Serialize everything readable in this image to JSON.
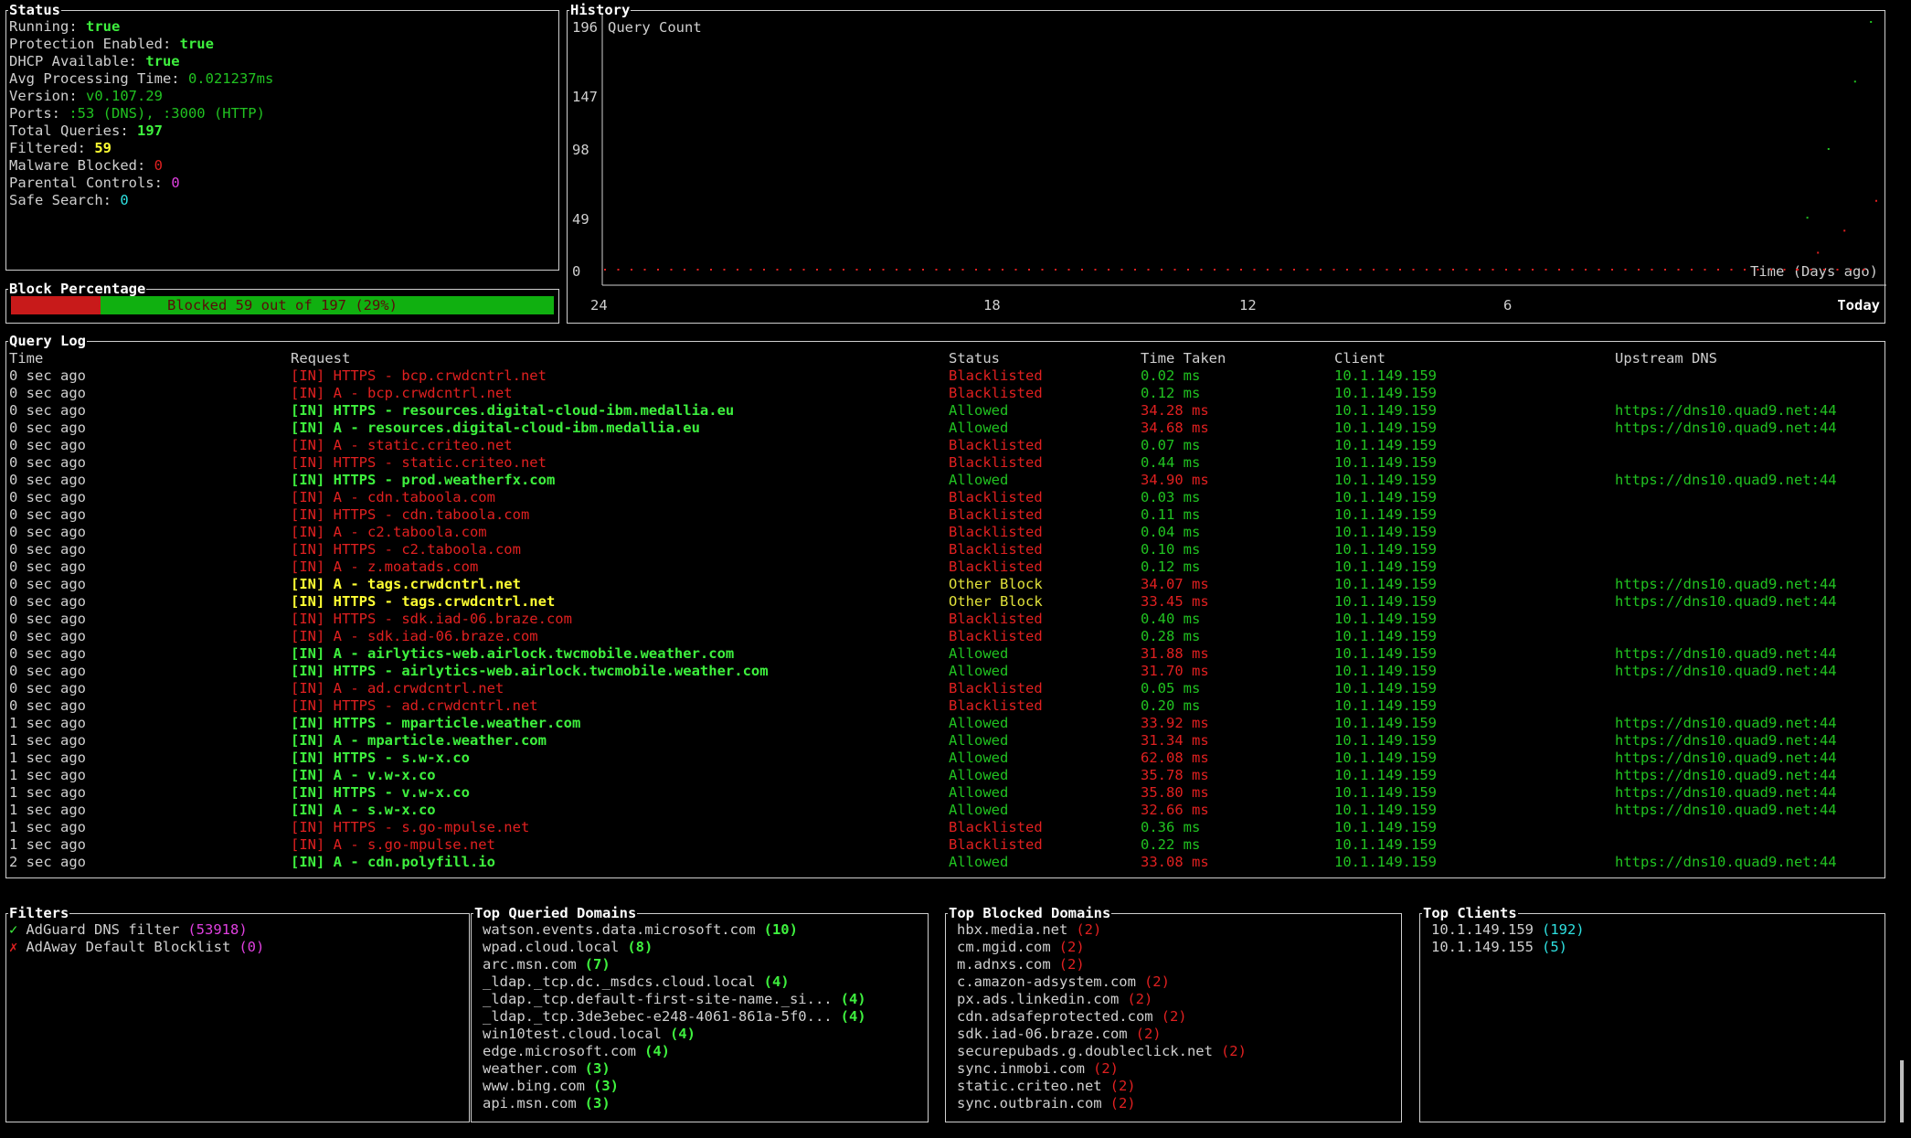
{
  "status": {
    "title": "Status",
    "items": [
      {
        "label": "Running: ",
        "value": "true",
        "cls": "gb"
      },
      {
        "label": "Protection Enabled: ",
        "value": "true",
        "cls": "gb"
      },
      {
        "label": "DHCP Available: ",
        "value": "true",
        "cls": "gb"
      },
      {
        "label": "Avg Processing Time: ",
        "value": "0.021237ms",
        "cls": "g"
      },
      {
        "label": "Version: ",
        "value": "v0.107.29",
        "cls": "g"
      },
      {
        "label": "Ports: ",
        "value": ":53 (DNS), :3000 (HTTP)",
        "cls": "g"
      },
      {
        "label": "Total Queries: ",
        "value": "197",
        "cls": "gb"
      },
      {
        "label": "Filtered: ",
        "value": "59",
        "cls": "y"
      },
      {
        "label": "Malware Blocked: ",
        "value": "0",
        "cls": "r"
      },
      {
        "label": "Parental Controls: ",
        "value": "0",
        "cls": "m"
      },
      {
        "label": "Safe Search: ",
        "value": "0",
        "cls": "c"
      }
    ]
  },
  "block_percentage": {
    "title": "Block Percentage",
    "text": "Blocked 59 out of 197 (29%)",
    "fraction": 0.2995
  },
  "history": {
    "title": "History",
    "series_label": "Query Count",
    "x_label": "Time (Days ago)",
    "y_ticks": [
      "196",
      "147",
      "98",
      "49",
      "0"
    ],
    "x_ticks": [
      "24",
      "18",
      "12",
      "6",
      "Today"
    ]
  },
  "chart_data": {
    "type": "scatter",
    "title": "History",
    "xlabel": "Time (Days ago)",
    "ylabel": "Query Count",
    "ylim": [
      0,
      196
    ],
    "xlim": [
      24,
      0
    ],
    "series": [
      {
        "color": "#21c221",
        "x": [
          0.1,
          0.4,
          0.9,
          1.3
        ],
        "y": [
          196,
          150,
          98,
          45
        ]
      },
      {
        "color": "#e02020",
        "x": [
          0.0,
          0.6,
          1.1,
          1.5
        ],
        "y": [
          58,
          35,
          18,
          5
        ]
      }
    ]
  },
  "query_log": {
    "title": "Query Log",
    "headers": [
      "Time",
      "Request",
      "Status",
      "Time Taken",
      "Client",
      "Upstream DNS"
    ],
    "rows": [
      [
        "0 sec ago",
        "[IN] HTTPS - bcp.crwdcntrl.net",
        "Blacklisted",
        "0.02 ms",
        "10.1.149.159",
        "",
        "b"
      ],
      [
        "0 sec ago",
        "[IN] A - bcp.crwdcntrl.net",
        "Blacklisted",
        "0.12 ms",
        "10.1.149.159",
        "",
        "b"
      ],
      [
        "0 sec ago",
        "[IN] HTTPS - resources.digital-cloud-ibm.medallia.eu",
        "Allowed",
        "34.28 ms",
        "10.1.149.159",
        "https://dns10.quad9.net:44",
        "a"
      ],
      [
        "0 sec ago",
        "[IN] A - resources.digital-cloud-ibm.medallia.eu",
        "Allowed",
        "34.68 ms",
        "10.1.149.159",
        "https://dns10.quad9.net:44",
        "a"
      ],
      [
        "0 sec ago",
        "[IN] A - static.criteo.net",
        "Blacklisted",
        "0.07 ms",
        "10.1.149.159",
        "",
        "b"
      ],
      [
        "0 sec ago",
        "[IN] HTTPS - static.criteo.net",
        "Blacklisted",
        "0.44 ms",
        "10.1.149.159",
        "",
        "b"
      ],
      [
        "0 sec ago",
        "[IN] HTTPS - prod.weatherfx.com",
        "Allowed",
        "34.90 ms",
        "10.1.149.159",
        "https://dns10.quad9.net:44",
        "a"
      ],
      [
        "0 sec ago",
        "[IN] A - cdn.taboola.com",
        "Blacklisted",
        "0.03 ms",
        "10.1.149.159",
        "",
        "b"
      ],
      [
        "0 sec ago",
        "[IN] HTTPS - cdn.taboola.com",
        "Blacklisted",
        "0.11 ms",
        "10.1.149.159",
        "",
        "b"
      ],
      [
        "0 sec ago",
        "[IN] A - c2.taboola.com",
        "Blacklisted",
        "0.04 ms",
        "10.1.149.159",
        "",
        "b"
      ],
      [
        "0 sec ago",
        "[IN] HTTPS - c2.taboola.com",
        "Blacklisted",
        "0.10 ms",
        "10.1.149.159",
        "",
        "b"
      ],
      [
        "0 sec ago",
        "[IN] A - z.moatads.com",
        "Blacklisted",
        "0.12 ms",
        "10.1.149.159",
        "",
        "b"
      ],
      [
        "0 sec ago",
        "[IN] A - tags.crwdcntrl.net",
        "Other Block",
        "34.07 ms",
        "10.1.149.159",
        "https://dns10.quad9.net:44",
        "o"
      ],
      [
        "0 sec ago",
        "[IN] HTTPS - tags.crwdcntrl.net",
        "Other Block",
        "33.45 ms",
        "10.1.149.159",
        "https://dns10.quad9.net:44",
        "o"
      ],
      [
        "0 sec ago",
        "[IN] HTTPS - sdk.iad-06.braze.com",
        "Blacklisted",
        "0.40 ms",
        "10.1.149.159",
        "",
        "b"
      ],
      [
        "0 sec ago",
        "[IN] A - sdk.iad-06.braze.com",
        "Blacklisted",
        "0.28 ms",
        "10.1.149.159",
        "",
        "b"
      ],
      [
        "0 sec ago",
        "[IN] A - airlytics-web.airlock.twcmobile.weather.com",
        "Allowed",
        "31.88 ms",
        "10.1.149.159",
        "https://dns10.quad9.net:44",
        "a"
      ],
      [
        "0 sec ago",
        "[IN] HTTPS - airlytics-web.airlock.twcmobile.weather.com",
        "Allowed",
        "31.70 ms",
        "10.1.149.159",
        "https://dns10.quad9.net:44",
        "a"
      ],
      [
        "0 sec ago",
        "[IN] A - ad.crwdcntrl.net",
        "Blacklisted",
        "0.05 ms",
        "10.1.149.159",
        "",
        "b"
      ],
      [
        "0 sec ago",
        "[IN] HTTPS - ad.crwdcntrl.net",
        "Blacklisted",
        "0.20 ms",
        "10.1.149.159",
        "",
        "b"
      ],
      [
        "1 sec ago",
        "[IN] HTTPS - mparticle.weather.com",
        "Allowed",
        "33.92 ms",
        "10.1.149.159",
        "https://dns10.quad9.net:44",
        "a"
      ],
      [
        "1 sec ago",
        "[IN] A - mparticle.weather.com",
        "Allowed",
        "31.34 ms",
        "10.1.149.159",
        "https://dns10.quad9.net:44",
        "a"
      ],
      [
        "1 sec ago",
        "[IN] HTTPS - s.w-x.co",
        "Allowed",
        "62.08 ms",
        "10.1.149.159",
        "https://dns10.quad9.net:44",
        "a"
      ],
      [
        "1 sec ago",
        "[IN] A - v.w-x.co",
        "Allowed",
        "35.78 ms",
        "10.1.149.159",
        "https://dns10.quad9.net:44",
        "a"
      ],
      [
        "1 sec ago",
        "[IN] HTTPS - v.w-x.co",
        "Allowed",
        "35.80 ms",
        "10.1.149.159",
        "https://dns10.quad9.net:44",
        "a"
      ],
      [
        "1 sec ago",
        "[IN] A - s.w-x.co",
        "Allowed",
        "32.66 ms",
        "10.1.149.159",
        "https://dns10.quad9.net:44",
        "a"
      ],
      [
        "1 sec ago",
        "[IN] HTTPS - s.go-mpulse.net",
        "Blacklisted",
        "0.36 ms",
        "10.1.149.159",
        "",
        "b"
      ],
      [
        "1 sec ago",
        "[IN] A - s.go-mpulse.net",
        "Blacklisted",
        "0.22 ms",
        "10.1.149.159",
        "",
        "b"
      ],
      [
        "2 sec ago",
        "[IN] A - cdn.polyfill.io",
        "Allowed",
        "33.08 ms",
        "10.1.149.159",
        "https://dns10.quad9.net:44",
        "a"
      ]
    ]
  },
  "filters": {
    "title": "Filters",
    "items": [
      {
        "icon": "✓",
        "icon_name": "check-icon",
        "name": "AdGuard DNS filter",
        "count": "(53918)",
        "ok": true
      },
      {
        "icon": "✗",
        "icon_name": "cross-icon",
        "name": "AdAway Default Blocklist",
        "count": "(0)",
        "ok": false
      }
    ]
  },
  "top_queried": {
    "title": "Top Queried Domains",
    "items": [
      [
        "watson.events.data.microsoft.com",
        "(10)"
      ],
      [
        "wpad.cloud.local",
        "(8)"
      ],
      [
        "arc.msn.com",
        "(7)"
      ],
      [
        "_ldap._tcp.dc._msdcs.cloud.local",
        "(4)"
      ],
      [
        "_ldap._tcp.default-first-site-name._si...",
        "(4)"
      ],
      [
        "_ldap._tcp.3de3ebec-e248-4061-861a-5f0...",
        "(4)"
      ],
      [
        "win10test.cloud.local",
        "(4)"
      ],
      [
        "edge.microsoft.com",
        "(4)"
      ],
      [
        "weather.com",
        "(3)"
      ],
      [
        "www.bing.com",
        "(3)"
      ],
      [
        "api.msn.com",
        "(3)"
      ]
    ]
  },
  "top_blocked": {
    "title": "Top Blocked Domains",
    "items": [
      [
        "hbx.media.net",
        "(2)"
      ],
      [
        "cm.mgid.com",
        "(2)"
      ],
      [
        "m.adnxs.com",
        "(2)"
      ],
      [
        "c.amazon-adsystem.com",
        "(2)"
      ],
      [
        "px.ads.linkedin.com",
        "(2)"
      ],
      [
        "cdn.adsafeprotected.com",
        "(2)"
      ],
      [
        "sdk.iad-06.braze.com",
        "(2)"
      ],
      [
        "securepubads.g.doubleclick.net",
        "(2)"
      ],
      [
        "sync.inmobi.com",
        "(2)"
      ],
      [
        "static.criteo.net",
        "(2)"
      ],
      [
        "sync.outbrain.com",
        "(2)"
      ]
    ]
  },
  "top_clients": {
    "title": "Top Clients",
    "items": [
      [
        "10.1.149.159",
        "(192)"
      ],
      [
        "10.1.149.155",
        "(5)"
      ]
    ]
  }
}
